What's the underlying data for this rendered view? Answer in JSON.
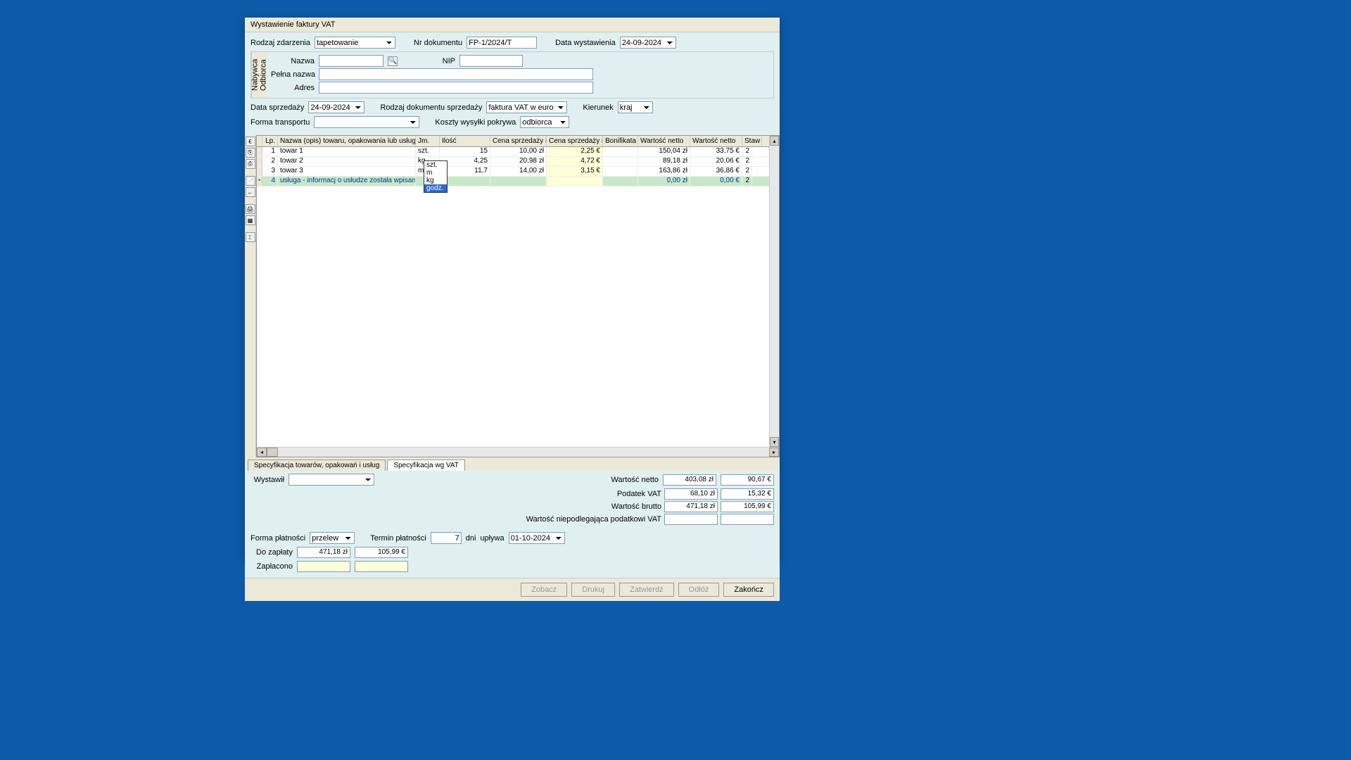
{
  "title": "Wystawienie faktury VAT",
  "header": {
    "rodzaj_zdarzenia_label": "Rodzaj zdarzenia",
    "rodzaj_zdarzenia": "tapetowanie",
    "nr_dokumentu_label": "Nr dokumentu",
    "nr_dokumentu": "FP-1/2024/T",
    "data_wystawienia_label": "Data wystawienia",
    "data_wystawienia": "24-09-2024"
  },
  "buyer": {
    "tab1": "Nabywca",
    "tab2": "Odbiorca",
    "nazwa_label": "Nazwa",
    "nazwa": "",
    "nip_label": "NIP",
    "nip": "",
    "pelna_nazwa_label": "Pełna nazwa",
    "pelna_nazwa": "",
    "adres_label": "Adres",
    "adres": ""
  },
  "sale": {
    "data_sprzedazy_label": "Data sprzedaży",
    "data_sprzedazy": "24-09-2024",
    "rodzaj_dok_label": "Rodzaj dokumentu sprzedaży",
    "rodzaj_dok": "faktura VAT w euro",
    "kierunek_label": "Kierunek",
    "kierunek": "kraj",
    "forma_transportu_label": "Forma transportu",
    "forma_transportu": "",
    "koszty_label": "Koszty wysyłki pokrywa",
    "koszty": "odbiorca"
  },
  "toolbar_icons": [
    "€",
    "⎘",
    "⎙",
    "📄",
    "←",
    "🖨",
    "▦",
    "Σ"
  ],
  "grid": {
    "headers": [
      "Lp.",
      "Nazwa (opis) towaru, opakowania lub usługi",
      "Jm.",
      "Ilość",
      "Cena sprzedaży netto",
      "Cena sprzedaży netto",
      "Bonifikata",
      "Wartość netto",
      "Wartość netto",
      "Staw"
    ],
    "rows": [
      {
        "lp": "1",
        "nazwa": "towar 1",
        "jm": "szt.",
        "ilosc": "15",
        "cena1": "10,00 zł",
        "cena2": "2,25 €",
        "bonifikata": "",
        "wartosc1": "150,04 zł",
        "wartosc2": "33,75 €",
        "staw": "2"
      },
      {
        "lp": "2",
        "nazwa": "towar 2",
        "jm": "kg",
        "ilosc": "4,25",
        "cena1": "20,98 zł",
        "cena2": "4,72 €",
        "bonifikata": "",
        "wartosc1": "89,18 zł",
        "wartosc2": "20,06 €",
        "staw": "2"
      },
      {
        "lp": "3",
        "nazwa": "towar 3",
        "jm": "m",
        "ilosc": "11,7",
        "cena1": "14,00 zł",
        "cena2": "3,15 €",
        "bonifikata": "",
        "wartosc1": "163,86 zł",
        "wartosc2": "36,86 €",
        "staw": "2"
      },
      {
        "lp": "4",
        "nazwa": "usługa - informacj o usłudze została wpisana bezpośr",
        "jm": "",
        "ilosc": "",
        "cena1": "",
        "cena2": "",
        "bonifikata": "",
        "wartosc1": "0,00 zł",
        "wartosc2": "0,00 €",
        "staw": "2"
      }
    ],
    "jm_options": [
      "szt.",
      "m",
      "kg",
      "godz."
    ],
    "jm_selected": "godz."
  },
  "tabs": {
    "tab1": "Specyfikacja towarów, opakowań i usług",
    "tab2": "Specyfikacja wg VAT"
  },
  "wystawil_label": "Wystawił",
  "wystawil": "",
  "totals": {
    "wartosc_netto_label": "Wartość netto",
    "wartosc_netto_zl": "403,08 zł",
    "wartosc_netto_eur": "90,67 €",
    "podatek_vat_label": "Podatek VAT",
    "podatek_vat_zl": "68,10 zł",
    "podatek_vat_eur": "15,32 €",
    "wartosc_brutto_label": "Wartość brutto",
    "wartosc_brutto_zl": "471,18 zł",
    "wartosc_brutto_eur": "105,99 €",
    "niepodlega_label": "Wartość niepodlegająca podatkowi VAT",
    "niepodlega_zl": "",
    "niepodlega_eur": ""
  },
  "payment": {
    "forma_label": "Forma płatności",
    "forma": "przelew",
    "termin_label": "Termin płatności",
    "termin_dni": "7",
    "dni_label": "dni",
    "uplywa_label": "upływa",
    "uplywa": "01-10-2024",
    "do_zaplaty_label": "Do zapłaty",
    "do_zaplaty_zl": "471,18 zł",
    "do_zaplaty_eur": "105,99 €",
    "zaplacono_label": "Zapłacono",
    "zaplacono_zl": "",
    "zaplacono_eur": ""
  },
  "buttons": {
    "zobacz": "Zobacz",
    "drukuj": "Drukuj",
    "zatwierdz": "Zatwierdź",
    "odloz": "Odłóż",
    "zakoncz": "Zakończ"
  }
}
